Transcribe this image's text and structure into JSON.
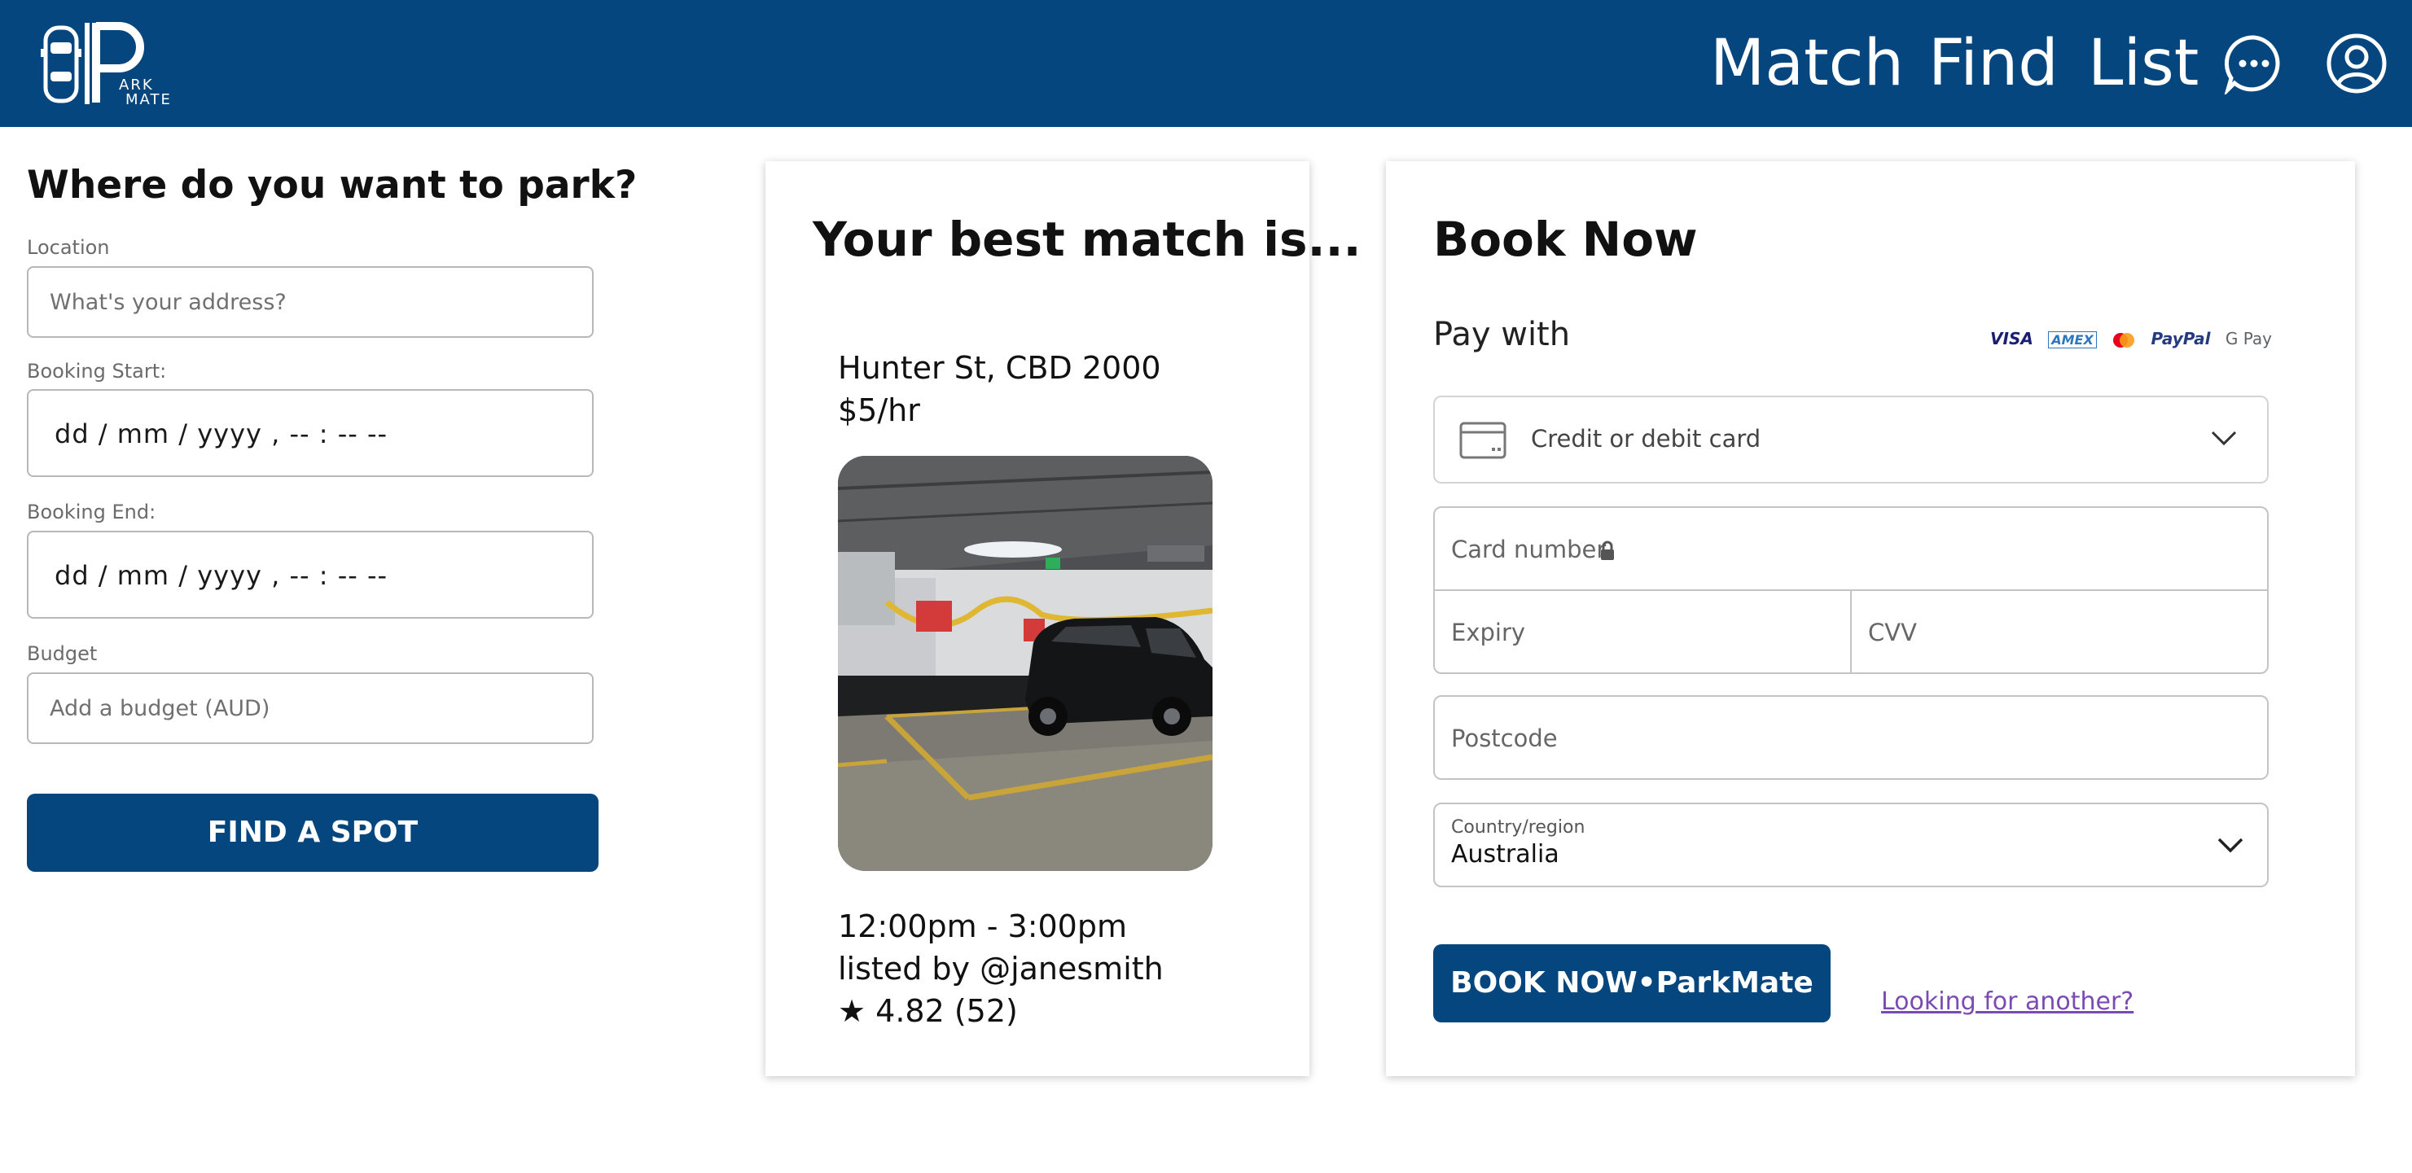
{
  "nav": {
    "logo_text": "PARK MATE",
    "links": [
      "Match",
      "Find",
      "List"
    ],
    "chat_icon": "chat-bubble-icon",
    "profile_icon": "user-circle-icon",
    "background": "#06467f"
  },
  "search": {
    "title": "Where do you want to park?",
    "location_label": "Location",
    "location_placeholder": "What's your address?",
    "start_label": "Booking Start:",
    "start_value": "dd / mm / yyyy ,  -- : --   --",
    "end_label": "Booking End:",
    "end_value": "dd / mm / yyyy ,  -- : --   --",
    "budget_label": "Budget",
    "budget_placeholder": "Add a budget (AUD)",
    "button": "FIND A SPOT"
  },
  "match": {
    "title": "Your best match is...",
    "address": "Hunter St, CBD 2000",
    "price": "$5/hr",
    "time": "12:00pm - 3:00pm",
    "listed_by": "listed by @janesmith",
    "rating": "★ 4.82 (52)"
  },
  "booking": {
    "title": "Book Now",
    "pay_with": "Pay with",
    "payment_logos": [
      "VISA",
      "AMEX",
      "PayPal",
      "G Pay"
    ],
    "payment_method": "Credit or debit card",
    "card_number": "Card number",
    "expiry": "Expiry",
    "cvv": "CVV",
    "postcode": "Postcode",
    "country_label": "Country/region",
    "country_value": "Australia",
    "button": "BOOK NOW•ParkMate",
    "link": "Looking for another?"
  },
  "colors": {
    "brand": "#06467f",
    "link": "#7a4bb3"
  }
}
